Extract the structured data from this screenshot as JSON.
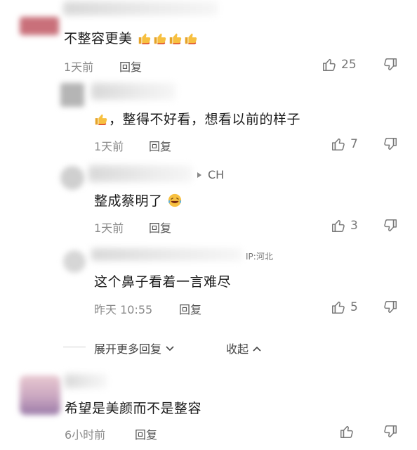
{
  "comments": [
    {
      "content": "不整容更美",
      "time": "1天前",
      "reply": "回复",
      "likes": "25"
    },
    {
      "content": "，整得不好看，想看以前的样子",
      "time": "1天前",
      "reply": "回复",
      "likes": "7"
    },
    {
      "tag": "CH",
      "content": "整成蔡明了",
      "time": "1天前",
      "reply": "回复",
      "likes": "3"
    },
    {
      "ip": "IP:河北",
      "content": "这个鼻子看着一言难尽",
      "time": "昨天 10:55",
      "reply": "回复",
      "likes": "5"
    },
    {
      "content": "希望是美颜而不是整容",
      "time": "6小时前",
      "reply": "回复",
      "likes": ""
    }
  ],
  "thread_actions": {
    "expand": "展开更多回复",
    "collapse": "收起"
  },
  "colors": {
    "text": "#1a1a1a",
    "meta": "#8a8a8a",
    "icon": "#777777"
  },
  "icons": [
    "thumbs-up-icon",
    "thumbs-down-icon",
    "thumbs-up-emoji",
    "laughing-emoji",
    "chevron-down-icon",
    "chevron-up-icon",
    "arrow-right-icon"
  ]
}
